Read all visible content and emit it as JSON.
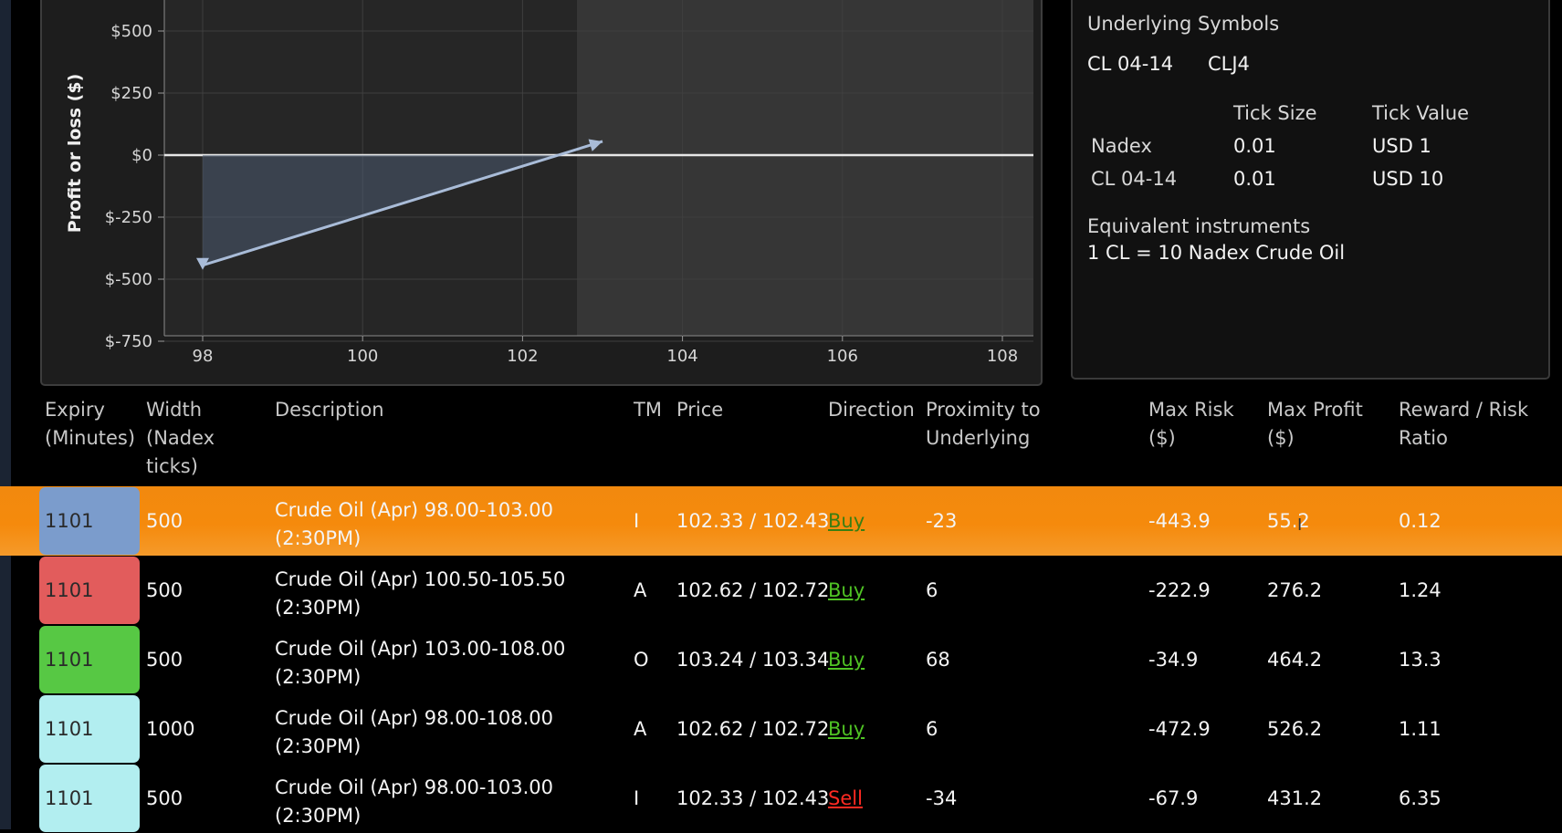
{
  "chart": {
    "ylabel": "Profit or loss ($)",
    "x_ticks": [
      "98",
      "100",
      "102",
      "104",
      "106",
      "108"
    ],
    "y_ticks": [
      "$500",
      "$250",
      "$0",
      "$-250",
      "$-500",
      "$-750"
    ]
  },
  "chart_data": {
    "type": "line",
    "title": "",
    "xlabel": "",
    "ylabel": "Profit or loss ($)",
    "xlim": [
      97,
      109.3
    ],
    "ylim": [
      -750,
      650
    ],
    "x_ticks": [
      98,
      100,
      102,
      104,
      106,
      108
    ],
    "y_ticks": [
      500,
      250,
      0,
      -250,
      -500,
      -750
    ],
    "grid": true,
    "series": [
      {
        "x": [
          98,
          103.0
        ],
        "y": [
          -443.9,
          55.2
        ]
      }
    ],
    "zero_line": 0,
    "current_price_boundary": 102.68
  },
  "info": {
    "underlying_title": "Underlying Symbols",
    "symbol_1": "CL 04-14",
    "symbol_2": "CLJ4",
    "tick_size_header": "Tick Size",
    "tick_value_header": "Tick Value",
    "rows": [
      {
        "name": "Nadex",
        "tick_size": "0.01",
        "tick_value": "USD 1"
      },
      {
        "name": "CL 04-14",
        "tick_size": "0.01",
        "tick_value": "USD 10"
      }
    ],
    "equiv_title": "Equivalent instruments",
    "equiv_value": "1 CL = 10 Nadex Crude Oil"
  },
  "table": {
    "headers": {
      "expiry": [
        "Expiry",
        "(Minutes)"
      ],
      "width": [
        "Width",
        "(Nadex",
        "ticks)"
      ],
      "description": [
        "Description"
      ],
      "tm": [
        "TM"
      ],
      "price": [
        "Price"
      ],
      "direction": [
        "Direction"
      ],
      "proximity": [
        "Proximity to",
        "Underlying"
      ],
      "max_risk": [
        "Max Risk",
        "($)"
      ],
      "max_profit": [
        "Max Profit",
        "($)"
      ],
      "reward_risk": [
        "Reward / Risk",
        "Ratio"
      ]
    },
    "rows": [
      {
        "expiry": "1101",
        "expiry_color": "#7b9ccc",
        "width": "500",
        "desc_1": "Crude Oil (Apr) 98.00-103.00",
        "desc_2": "(2:30PM)",
        "tm": "I",
        "price": "102.33 / 102.43",
        "direction": "Buy",
        "proximity": "-23",
        "max_risk": "-443.9",
        "max_profit": "55.2",
        "reward_risk": "0.12",
        "selected": true
      },
      {
        "expiry": "1101",
        "expiry_color": "#e25c5c",
        "width": "500",
        "desc_1": "Crude Oil (Apr) 100.50-105.50",
        "desc_2": "(2:30PM)",
        "tm": "A",
        "price": "102.62 / 102.72",
        "direction": "Buy",
        "proximity": "6",
        "max_risk": "-222.9",
        "max_profit": "276.2",
        "reward_risk": "1.24",
        "selected": false
      },
      {
        "expiry": "1101",
        "expiry_color": "#57c844",
        "width": "500",
        "desc_1": "Crude Oil (Apr) 103.00-108.00",
        "desc_2": "(2:30PM)",
        "tm": "O",
        "price": "103.24 / 103.34",
        "direction": "Buy",
        "proximity": "68",
        "max_risk": "-34.9",
        "max_profit": "464.2",
        "reward_risk": "13.3",
        "selected": false
      },
      {
        "expiry": "1101",
        "expiry_color": "#b2eef0",
        "width": "1000",
        "desc_1": "Crude Oil (Apr) 98.00-108.00",
        "desc_2": "(2:30PM)",
        "tm": "A",
        "price": "102.62 / 102.72",
        "direction": "Buy",
        "proximity": "6",
        "max_risk": "-472.9",
        "max_profit": "526.2",
        "reward_risk": "1.11",
        "selected": false
      },
      {
        "expiry": "1101",
        "expiry_color": "#b2eef0",
        "width": "500",
        "desc_1": "Crude Oil (Apr) 98.00-103.00",
        "desc_2": "(2:30PM)",
        "tm": "I",
        "price": "102.33 / 102.43",
        "direction": "Sell",
        "proximity": "-34",
        "max_risk": "-67.9",
        "max_profit": "431.2",
        "reward_risk": "6.35",
        "selected": false
      }
    ]
  }
}
